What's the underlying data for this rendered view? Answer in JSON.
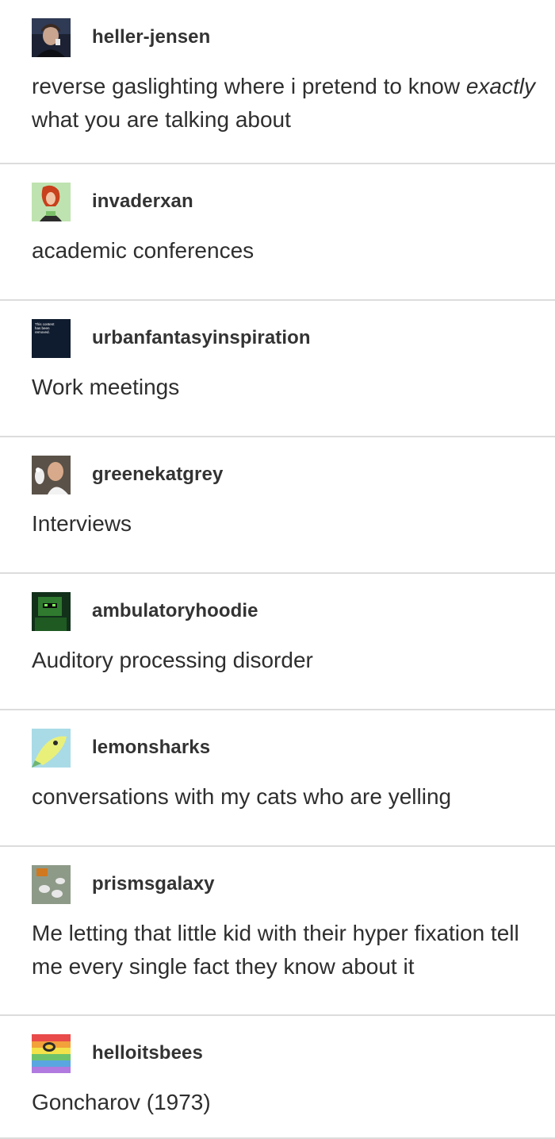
{
  "posts": [
    {
      "username": "heller-jensen",
      "text_before": "reverse gaslighting where i pretend to know ",
      "text_emph": "exactly",
      "text_after": " what you are talking about"
    },
    {
      "username": "invaderxan",
      "text": "academic conferences"
    },
    {
      "username": "urbanfantasyinspiration",
      "text": "Work meetings",
      "avatar_text": "This content has been removed."
    },
    {
      "username": "greenekatgrey",
      "text": "Interviews"
    },
    {
      "username": "ambulatoryhoodie",
      "text": "Auditory processing disorder"
    },
    {
      "username": "lemonsharks",
      "text": "conversations with my cats who are yelling"
    },
    {
      "username": "prismsgalaxy",
      "text": "Me letting that little kid with their hyper fixation tell me every single fact they know about it"
    },
    {
      "username": "helloitsbees",
      "text": "Goncharov (1973)"
    }
  ],
  "colors": {
    "divider": "#dcdcdc",
    "text": "#2e2e2e",
    "username": "#333333"
  }
}
